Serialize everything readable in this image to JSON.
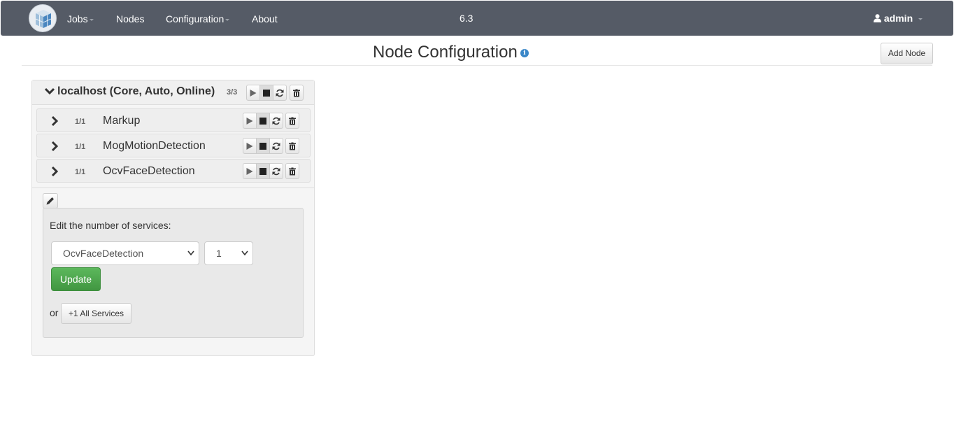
{
  "navbar": {
    "logo_icon": "cube-logo-icon",
    "items": [
      {
        "label": "Jobs",
        "has_dropdown": true
      },
      {
        "label": "Nodes",
        "has_dropdown": false
      },
      {
        "label": "Configuration",
        "has_dropdown": true
      },
      {
        "label": "About",
        "has_dropdown": false
      }
    ],
    "version": "6.3",
    "user": {
      "icon": "user-icon",
      "label": "admin"
    }
  },
  "page": {
    "title": "Node Configuration",
    "info_icon": "info-icon",
    "add_node_label": "Add Node"
  },
  "node": {
    "title": "localhost (Core, Auto, Online)",
    "count": "3/3",
    "services": [
      {
        "count": "1/1",
        "name": "Markup"
      },
      {
        "count": "1/1",
        "name": "MogMotionDetection"
      },
      {
        "count": "1/1",
        "name": "OcvFaceDetection"
      }
    ]
  },
  "edit": {
    "label": "Edit the number of services:",
    "service_select": "OcvFaceDetection",
    "count_select": "1",
    "update_label": "Update",
    "or_label": "or",
    "all_services_label": "+1 All Services"
  },
  "colors": {
    "navbar": "#555b66",
    "update_green": "#5cb85c",
    "info_blue": "#3a87c8"
  }
}
